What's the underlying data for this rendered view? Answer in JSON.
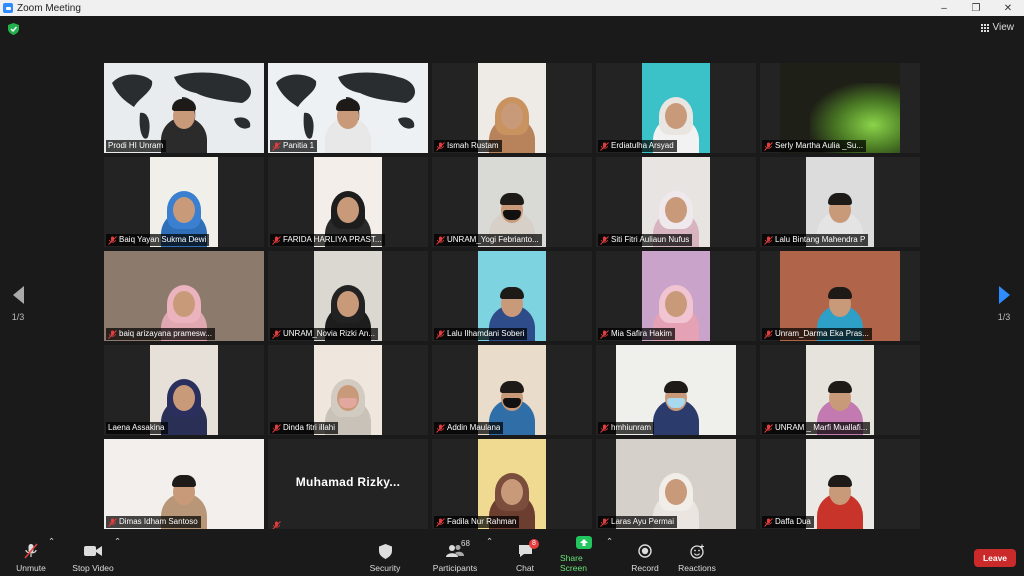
{
  "window": {
    "title": "Zoom Meeting"
  },
  "view": {
    "label": "View"
  },
  "pager": {
    "left": "1/3",
    "right": "1/3"
  },
  "participants": [
    {
      "name": "Prodi HI Unram",
      "bg": "#e9ecee",
      "video": "full",
      "shirt": "#2b2b2b",
      "head": "hair",
      "active": true,
      "muted": false,
      "map": true
    },
    {
      "name": "Panitia 1",
      "bg": "#eef1f3",
      "video": "full",
      "shirt": "#e8e8e8",
      "head": "hair",
      "muted": true,
      "map": true
    },
    {
      "name": "Ismah Rustam",
      "bg": "#eeeae6",
      "video": "w68",
      "shirt": "#b8825a",
      "head": "hijab",
      "hijabColor": "#c9935f",
      "muted": true
    },
    {
      "name": "Erdiatulha Arsyad",
      "bg": "#3bc2c8",
      "video": "w68",
      "shirt": "#f2f2f2",
      "head": "hijab",
      "hijabColor": "#e9e6e2",
      "muted": true
    },
    {
      "name": "Serly Martha Aulia _Su...",
      "bg": "#1e1f17",
      "video": "w120",
      "shirt": "#6da73a",
      "head": "none",
      "muted": true
    },
    {
      "name": "Baiq Yayan Sukma Dewi",
      "bg": "#f1efe9",
      "video": "w68",
      "shirt": "#2f6fb8",
      "head": "hijab",
      "hijabColor": "#3a7fd0",
      "muted": true
    },
    {
      "name": "FARIDA HARLIYA PRAST...",
      "bg": "#f4eeea",
      "video": "w68",
      "shirt": "#2a2a2a",
      "head": "hijab",
      "hijabColor": "#1d1d1d",
      "muted": true
    },
    {
      "name": "UNRAM_Yogi Febrianto...",
      "bg": "#d9d9d6",
      "video": "w68",
      "shirt": "#d6d0c9",
      "head": "hair",
      "mask": "#111111",
      "muted": true
    },
    {
      "name": "Siti Fitri Auliaun Nufus",
      "bg": "#e7e4e2",
      "video": "w68",
      "shirt": "#d8b3c0",
      "head": "hijab",
      "hijabColor": "#efe9ee",
      "muted": true
    },
    {
      "name": "Lalu Bintang Mahendra P",
      "bg": "#dcdcdc",
      "video": "w68",
      "shirt": "#e4e4e4",
      "head": "hair",
      "muted": true
    },
    {
      "name": "baiq arizayana pramesw...",
      "bg": "#8c7a6d",
      "video": "full",
      "shirt": "#e0a8b0",
      "head": "hijab",
      "hijabColor": "#eab3bd",
      "muted": true
    },
    {
      "name": "UNRAM_Novia Rizki An...",
      "bg": "#dbd7d1",
      "video": "w68",
      "shirt": "#1d1d1d",
      "head": "hijab",
      "hijabColor": "#222222",
      "muted": true
    },
    {
      "name": "Lalu Ilhamdani Soberi",
      "bg": "#7ed3e0",
      "video": "w68",
      "shirt": "#2e4c8a",
      "head": "hair",
      "muted": true
    },
    {
      "name": "Mia Safira Hakim",
      "bg": "#c9a3c9",
      "video": "w68",
      "shirt": "#e5a2b5",
      "head": "hijab",
      "hijabColor": "#f1c4d2",
      "muted": true
    },
    {
      "name": "Unram_Darma Eka Pras...",
      "bg": "#b0654a",
      "video": "w120",
      "shirt": "#2ea0c7",
      "head": "hair",
      "muted": true
    },
    {
      "name": "Laena Assakina",
      "bg": "#e6e0d8",
      "video": "w68",
      "shirt": "#2a2f55",
      "head": "hijab",
      "hijabColor": "#2b2f5d",
      "muted": false
    },
    {
      "name": "Dinda fitri illahi",
      "bg": "#efe7dd",
      "video": "w68",
      "shirt": "#c8c2b8",
      "head": "hijab",
      "hijabColor": "#d2cbc1",
      "mask": "#e2a8a0",
      "muted": true
    },
    {
      "name": "Addin Maulana",
      "bg": "#e9dccb",
      "video": "w68",
      "shirt": "#2f6ea6",
      "head": "hair",
      "mask": "#111111",
      "muted": true
    },
    {
      "name": "hmhiunram",
      "bg": "#efefec",
      "video": "w120",
      "shirt": "#2b3b6b",
      "head": "hair",
      "mask": "#a9d9ef",
      "muted": true
    },
    {
      "name": "UNRAM _ Marfi Muallafi...",
      "bg": "#e6e2dc",
      "video": "w68",
      "shirt": "#c37ab0",
      "head": "hair",
      "muted": true
    },
    {
      "name": "Dimas Idham Santoso",
      "bg": "#f2efec",
      "video": "full",
      "shirt": "#b89778",
      "head": "hair",
      "muted": true
    },
    {
      "name": "Muhamad  Rizky...",
      "nameOnly": true,
      "muted": true
    },
    {
      "name": "Fadila Nur Rahman",
      "bg": "#f0d990",
      "video": "w68",
      "shirt": "#6b3e2f",
      "head": "hijab",
      "hijabColor": "#7a4d3c",
      "muted": true
    },
    {
      "name": "Laras Ayu Permai",
      "bg": "#d6d0ca",
      "video": "w120",
      "shirt": "#eae5e0",
      "head": "hijab",
      "hijabColor": "#f1ede9",
      "muted": true
    },
    {
      "name": "Daffa Dua",
      "bg": "#ebe9e6",
      "video": "w68",
      "shirt": "#c8332a",
      "head": "hair",
      "muted": true
    }
  ],
  "toolbar": {
    "unmute": "Unmute",
    "stop_video": "Stop Video",
    "security": "Security",
    "participants": "Participants",
    "participants_count": "68",
    "chat": "Chat",
    "chat_badge": "8",
    "share_screen": "Share Screen",
    "record": "Record",
    "reactions": "Reactions",
    "leave": "Leave"
  },
  "colors": {
    "accent": "#2d8cff",
    "active_speaker": "#cfe840",
    "leave": "#cb2a2a",
    "share": "#23c55e",
    "muted": "#e43d3d"
  }
}
